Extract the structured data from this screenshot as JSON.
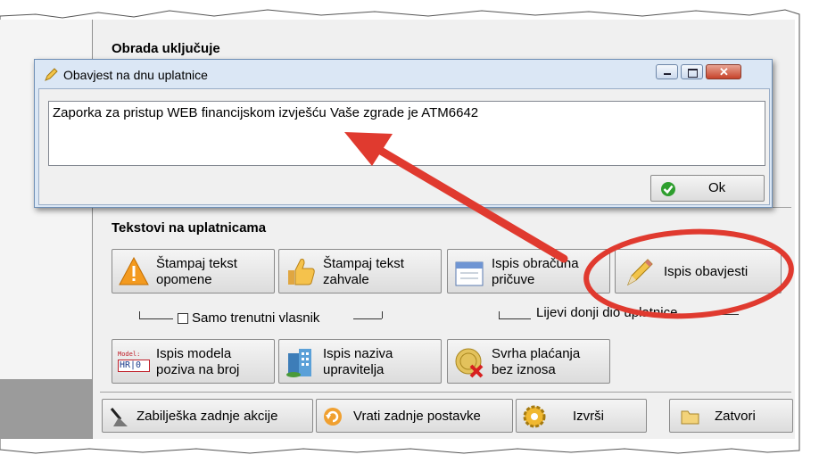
{
  "window": {
    "section_processing": "Obrada uključuje",
    "section_texts": "Tekstovi na uplatnicama"
  },
  "buttons": {
    "print_warning": "Štampaj tekst\nopomene",
    "print_praise": "Štampaj tekst\nzahvale",
    "print_reserve_calc": "Ispis obračuna\npričuve",
    "print_notice": "Ispis obavjesti",
    "print_model": "Ispis modela\npoziva na broj",
    "print_manager_name": "Ispis naziva\nupravitelja",
    "payment_purpose": "Svrha plaćanja\nbez iznosa",
    "last_action_note": "Zabilješka zadnje akcije",
    "restore_settings": "Vrati zadnje postavke",
    "execute": "Izvrši",
    "close": "Zatvori"
  },
  "options": {
    "current_owner_only": "Samo trenutni vlasnik",
    "bottom_left_part": "Lijevi donji dio uplatnice",
    "model_icon_text": "HR|0"
  },
  "dialog": {
    "title": "Obavjest na dnu uplatnice",
    "message": "Zaporka za pristup WEB financijskom izvješću Vaše zgrade je ATM6642",
    "ok_label": "Ok"
  },
  "colors": {
    "annotation_red": "#e03a2f",
    "dialog_frame": "#dbe7f5",
    "window_bg": "#f0f0f0"
  },
  "icons": [
    "warning-icon",
    "thumbs-up-icon",
    "calendar-icon",
    "pencil-icon",
    "model-icon",
    "building-icon",
    "no-money-icon",
    "broom-icon",
    "restore-icon",
    "gear-icon",
    "folder-icon",
    "check-icon"
  ]
}
